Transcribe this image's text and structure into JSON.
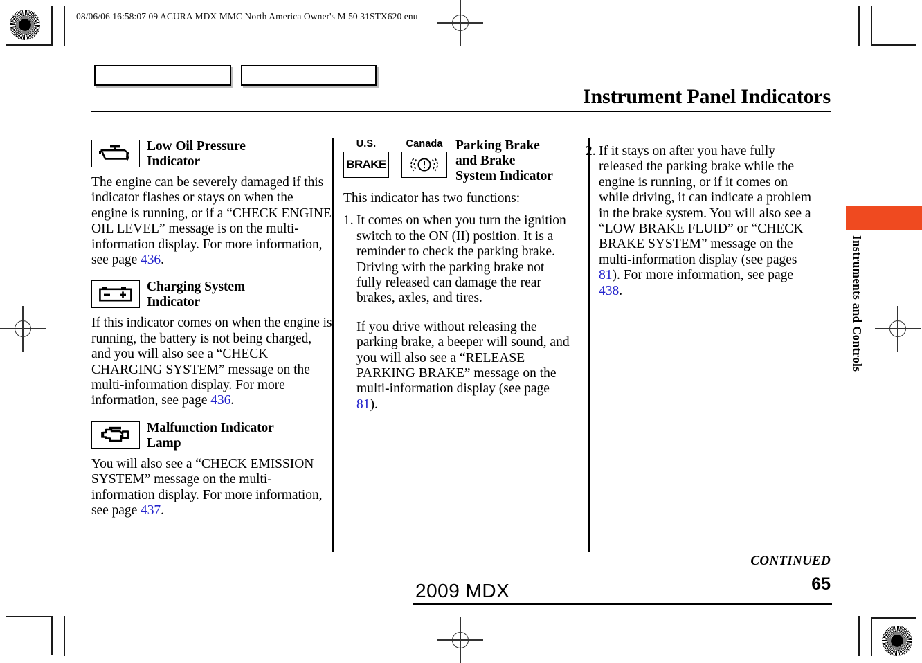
{
  "print_header": "08/06/06 16:58:07   09 ACURA MDX MMC North America Owner's M 50 31STX620 enu",
  "page_title": "Instrument Panel Indicators",
  "colors": {
    "accent_orange": "#ef4a20",
    "page_ref_blue": "#2222cc",
    "rule_black": "#000000"
  },
  "column_left": {
    "sections": [
      {
        "icon": "oil-can-icon",
        "title_line1": "Low Oil Pressure",
        "title_line2": "Indicator",
        "body_before": "The engine can be severely damaged if this indicator flashes or stays on when the engine is running, or if a “CHECK ENGINE OIL LEVEL” message is on the multi-information display. For more information, see page ",
        "page_ref": "436",
        "body_after": "."
      },
      {
        "icon": "battery-icon",
        "title_line1": "Charging System",
        "title_line2": "Indicator",
        "body_before": "If this indicator comes on when the engine is running, the battery is not being charged, and you will also see a “CHECK CHARGING SYSTEM” message on the multi-information display. For more information, see page ",
        "page_ref": "436",
        "body_after": "."
      },
      {
        "icon": "engine-malfunction-icon",
        "title_line1": "Malfunction Indicator",
        "title_line2": "Lamp",
        "body_before": "You will also see a “CHECK EMISSION SYSTEM” message on the multi-information display. For more information, see page ",
        "page_ref": "437",
        "body_after": "."
      }
    ]
  },
  "column_mid": {
    "region_us_label": "U.S.",
    "region_us_icon_text": "BRAKE",
    "region_canada_label": "Canada",
    "region_canada_icon": "brake-exclamation-icon",
    "title_line1": "Parking Brake",
    "title_line2": "and Brake",
    "title_line3": "System Indicator",
    "intro": "This indicator has two functions:",
    "item_number": "1.",
    "item_para1": "It comes on when you turn the ignition switch to the ON (II) position. It is a reminder to check the parking brake. Driving with the parking brake not fully released can damage the rear brakes, axles, and tires.",
    "item_para2_before": "If you drive without releasing the parking brake, a beeper will sound, and you will also see a “RELEASE PARKING BRAKE” message on the multi-information display (see page ",
    "item_para2_ref": "81",
    "item_para2_after": ")."
  },
  "column_right": {
    "item_number": "2.",
    "text_before_ref1": "If it stays on after you have fully released the parking brake while the engine is running, or if it comes on while driving, it can indicate a problem in the brake system. You will also see a “LOW BRAKE FLUID” or “CHECK BRAKE SYSTEM” message on the multi-information display (see pages ",
    "ref1": "81",
    "text_between": "). For more information, see page ",
    "ref2": "438",
    "text_after": "."
  },
  "side_tab": {
    "label": "Instruments and Controls"
  },
  "footer": {
    "continued": "CONTINUED",
    "model": "2009  MDX",
    "page_number": "65"
  }
}
